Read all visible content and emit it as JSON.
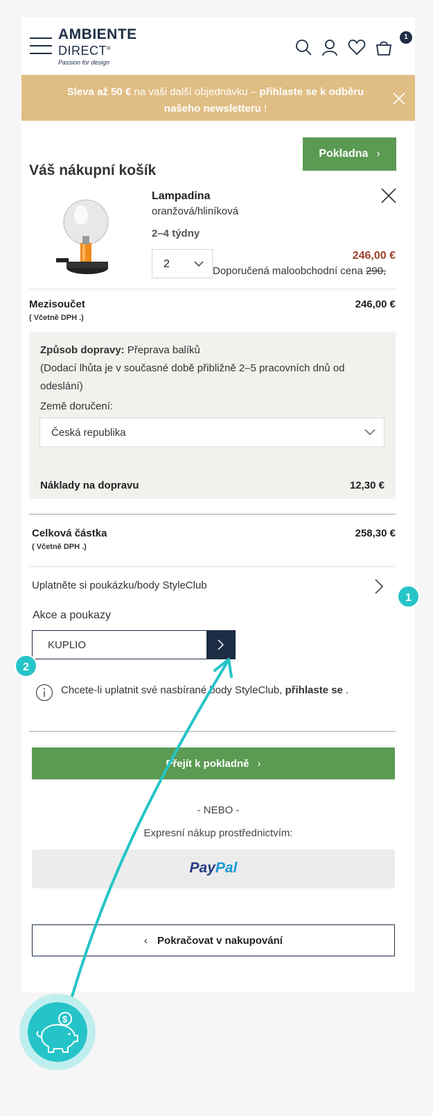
{
  "header": {
    "logo_line1": "AMBIENTE",
    "logo_line2": "DIRECT",
    "logo_reg": "®",
    "logo_tagline": "Passion for design",
    "cart_count": "1"
  },
  "banner": {
    "part1": "Sleva až 50 €",
    "part2": " na vaši další objednávku – ",
    "part3": "přihlaste se k odběru našeho newsletteru",
    "part4": " !"
  },
  "cart": {
    "title": "Váš nákupní košík",
    "checkout_label": "Pokladna"
  },
  "product": {
    "name": "Lampadina",
    "variant": "oranžová/hliníková",
    "delivery": "2–4 týdny",
    "quantity": "2",
    "price": "246,00 €",
    "rrp_label": "Doporučená maloobchodní cena ",
    "rrp_value": "290,"
  },
  "subtotal": {
    "label": "Mezisoučet",
    "vat": "( Včetně DPH .)",
    "value": "246,00 €"
  },
  "shipping": {
    "method_label": "Způsob dopravy:",
    "method_value": " Přeprava balíků",
    "method_note": "(Dodací lhůta je v současné době přibližně 2–5 pracovních dnů od odeslání)",
    "country_label": "Země doručení:",
    "country_value": "Česká republika",
    "cost_label": "Náklady na dopravu",
    "cost_value": "12,30 €"
  },
  "total": {
    "label": "Celková částka",
    "vat": "( Včetně DPH .)",
    "value": "258,30 €"
  },
  "voucher": {
    "link_label": "Uplatněte si poukázku/body StyleClub",
    "promo_label": "Akce a poukazy",
    "promo_value": "KUPLIO"
  },
  "info": {
    "text": "Chcete-li uplatnit své nasbírané body StyleClub, ",
    "link": "přihlaste se",
    "after": " ."
  },
  "checkout": {
    "main_label": "Přejít k pokladně",
    "or_label": "- NEBO -",
    "express_label": "Expresní nákup prostřednictvím:",
    "paypal_pay": "Pay",
    "paypal_pal": "Pal",
    "continue_label": "Pokračovat v nakupování"
  },
  "annotations": {
    "marker1": "1",
    "marker2": "2",
    "accent_color": "#25c4c8"
  },
  "colors": {
    "brand_navy": "#1d2d45",
    "green": "#5b9a53",
    "banner": "#e0bd83",
    "price_red": "#a0422b"
  }
}
